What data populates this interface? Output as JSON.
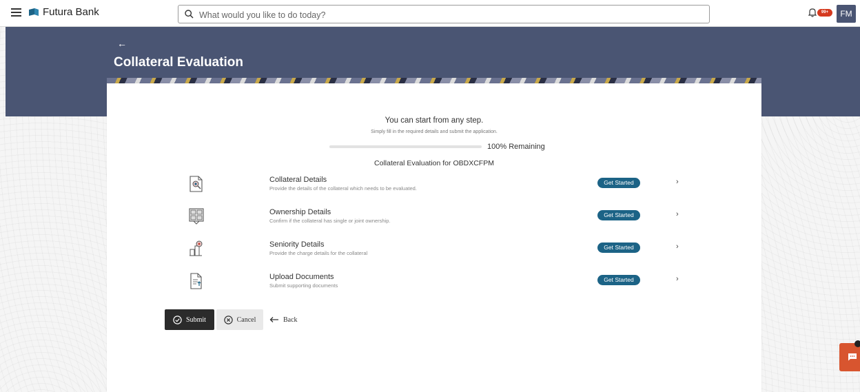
{
  "header": {
    "brand_name": "Futura Bank",
    "search_placeholder": "What would you like to do today?",
    "notification_badge": "99+",
    "avatar_initials": "FM"
  },
  "banner": {
    "back_icon": "←",
    "title": "Collateral Evaluation"
  },
  "intro": {
    "heading": "You can start from any step.",
    "subheading": "Simply fill in the required details and submit the application.",
    "progress_percent": 0,
    "progress_label": "100% Remaining",
    "section_title": "Collateral Evaluation for OBDXCFPM"
  },
  "steps": [
    {
      "title": "Collateral Details",
      "description": "Provide the details of the collateral which needs to be evaluated.",
      "button": "Get Started",
      "icon": "document-search-icon"
    },
    {
      "title": "Ownership Details",
      "description": "Confirm if the collateral has single or joint ownership.",
      "button": "Get Started",
      "icon": "ownership-icon"
    },
    {
      "title": "Seniority Details",
      "description": "Provide the charge details for the collateral",
      "button": "Get Started",
      "icon": "seniority-icon"
    },
    {
      "title": "Upload Documents",
      "description": "Submit supporting documents",
      "button": "Get Started",
      "icon": "upload-document-icon"
    }
  ],
  "actions": {
    "submit": "Submit",
    "cancel": "Cancel",
    "back": "Back"
  },
  "colors": {
    "banner": "#4a5573",
    "get_started": "#1c6386",
    "chat": "#d8552f",
    "badge": "#d53a1f"
  }
}
